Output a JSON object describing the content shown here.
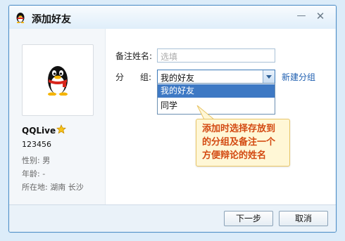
{
  "window": {
    "title": "添加好友",
    "accent": "#4e8ec6"
  },
  "profile": {
    "nickname": "QQLive",
    "id": "123456",
    "gender": "性别: 男",
    "age": "年龄: -",
    "location": "所在地: 湖南 长沙",
    "badge_icon": "star-icon",
    "avatar_icon": "qq-penguin-icon"
  },
  "form": {
    "remark_label": "备注姓名:",
    "remark_placeholder": "选填",
    "group_label_1": "分",
    "group_label_2": "组:",
    "group_value": "我的好友",
    "new_group_link": "新建分组",
    "group_options": [
      "我的好友",
      "同学"
    ]
  },
  "callout": {
    "text": "添加时选择存放到\n的分组及备注一个\n方便辩论的姓名",
    "color": "#d34a12"
  },
  "footer": {
    "next_label": "下一步",
    "cancel_label": "取消"
  }
}
